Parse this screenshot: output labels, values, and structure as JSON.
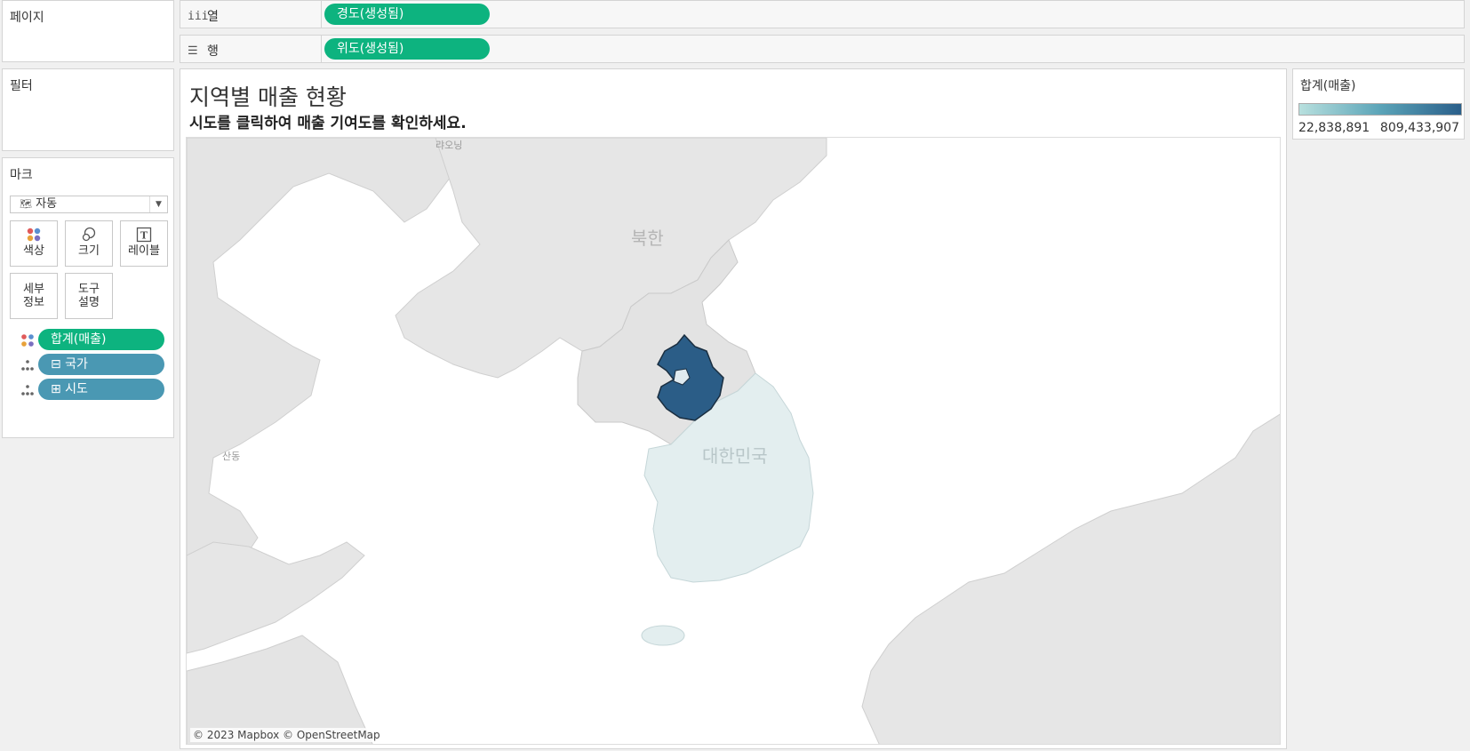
{
  "pages_card": {
    "title": "페이지"
  },
  "filters_card": {
    "title": "필터"
  },
  "marks_card": {
    "title": "마크",
    "mark_type": "자동",
    "buttons": {
      "color": "색상",
      "size": "크기",
      "label": "레이블",
      "detail_line1": "세부",
      "detail_line2": "정보",
      "tooltip_line1": "도구",
      "tooltip_line2": "설명"
    },
    "fields": [
      {
        "label": "합계(매출)",
        "kind": "color"
      },
      {
        "label": "⊟ 국가",
        "kind": "detail"
      },
      {
        "label": "⊞ 시도",
        "kind": "detail"
      }
    ]
  },
  "shelves": {
    "columns": {
      "label": "열",
      "pill": "경도(생성됨)"
    },
    "rows": {
      "label": "행",
      "pill": "위도(생성됨)"
    }
  },
  "dashboard": {
    "title": "지역별 매출 현황",
    "subtitle": "시도를 클릭하여 매출 기여도를 확인하세요."
  },
  "map": {
    "labels": {
      "north_korea": "북한",
      "south_korea": "대한민국",
      "shandong": "산동",
      "top": "랴오닝"
    },
    "attribution": "© 2023 Mapbox © OpenStreetMap",
    "colors": {
      "highlight": "#2b5d87",
      "region_fill": "#e3eeef",
      "land": "#e6e6e6",
      "sea": "#ffffff"
    }
  },
  "legend": {
    "title": "합계(매출)",
    "min": "22,838,891",
    "max": "809,433,907"
  }
}
